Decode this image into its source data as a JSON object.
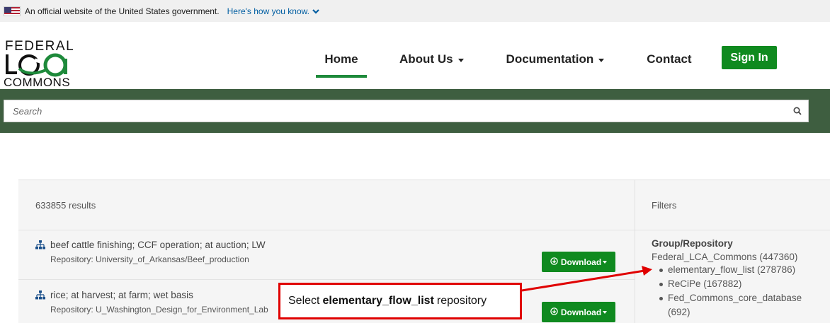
{
  "gov_banner": {
    "text": "An official website of the United States government.",
    "link": "Here's how you know."
  },
  "logo": {
    "line1": "FEDERAL",
    "line2": "LCA",
    "line3": "COMMONS"
  },
  "nav": {
    "home": "Home",
    "about": "About Us",
    "documentation": "Documentation",
    "contact": "Contact",
    "sign_in": "Sign In"
  },
  "search": {
    "placeholder": "Search"
  },
  "results": {
    "count": "633855 results",
    "items": [
      {
        "title": "beef cattle finishing; CCF operation; at auction; LW",
        "repository": "Repository: University_of_Arkansas/Beef_production",
        "download_label": "Download"
      },
      {
        "title": "rice; at harvest; at farm; wet basis",
        "repository": "Repository: U_Washington_Design_for_Environment_Lab",
        "download_label": "Download"
      }
    ]
  },
  "filters": {
    "title": "Filters",
    "group_title": "Group/Repository",
    "parent": "Federal_LCA_Commons (447360)",
    "items": [
      "elementary_flow_list (278786)",
      "ReCiPe (167882)",
      "Fed_Commons_core_database",
      "(692)"
    ]
  },
  "callout": {
    "prefix": "Select",
    "bold": "elementary_flow_list",
    "suffix": "repository"
  },
  "colors": {
    "accent_green": "#0f8a1f",
    "band_green": "#3e5e40",
    "callout_red": "#e00000",
    "link_blue": "#005ea2"
  }
}
